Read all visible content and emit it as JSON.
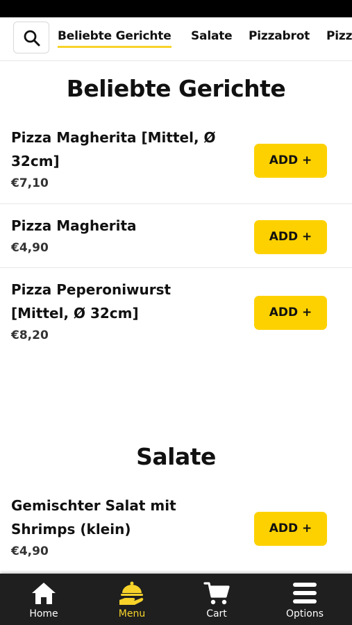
{
  "categories": [
    "Beliebte Gerichte",
    "Salate",
    "Pizzabrot",
    "Pizza"
  ],
  "sections": [
    {
      "title": "Beliebte Gerichte",
      "items": [
        {
          "name": "Pizza Magherita [Mittel, Ø 32cm]",
          "price": "€7,10",
          "button": "ADD +"
        },
        {
          "name": "Pizza Magherita",
          "price": "€4,90",
          "button": "ADD +"
        },
        {
          "name": "Pizza Peperoniwurst [Mittel, Ø 32cm]",
          "price": "€8,20",
          "button": "ADD +"
        }
      ]
    },
    {
      "title": "Salate",
      "items": [
        {
          "name": "Gemischter Salat mit Shrimps (klein)",
          "price": "€4,90",
          "button": "ADD +"
        }
      ]
    }
  ],
  "nav": [
    {
      "label": "Home",
      "icon": "home-icon"
    },
    {
      "label": "Menu",
      "icon": "menu-cloche-icon"
    },
    {
      "label": "Cart",
      "icon": "cart-icon"
    },
    {
      "label": "Options",
      "icon": "hamburger-icon"
    }
  ],
  "colors": {
    "accent": "#fdd100",
    "nav_bg": "#1f1f1f",
    "active": "#f7d32a"
  }
}
